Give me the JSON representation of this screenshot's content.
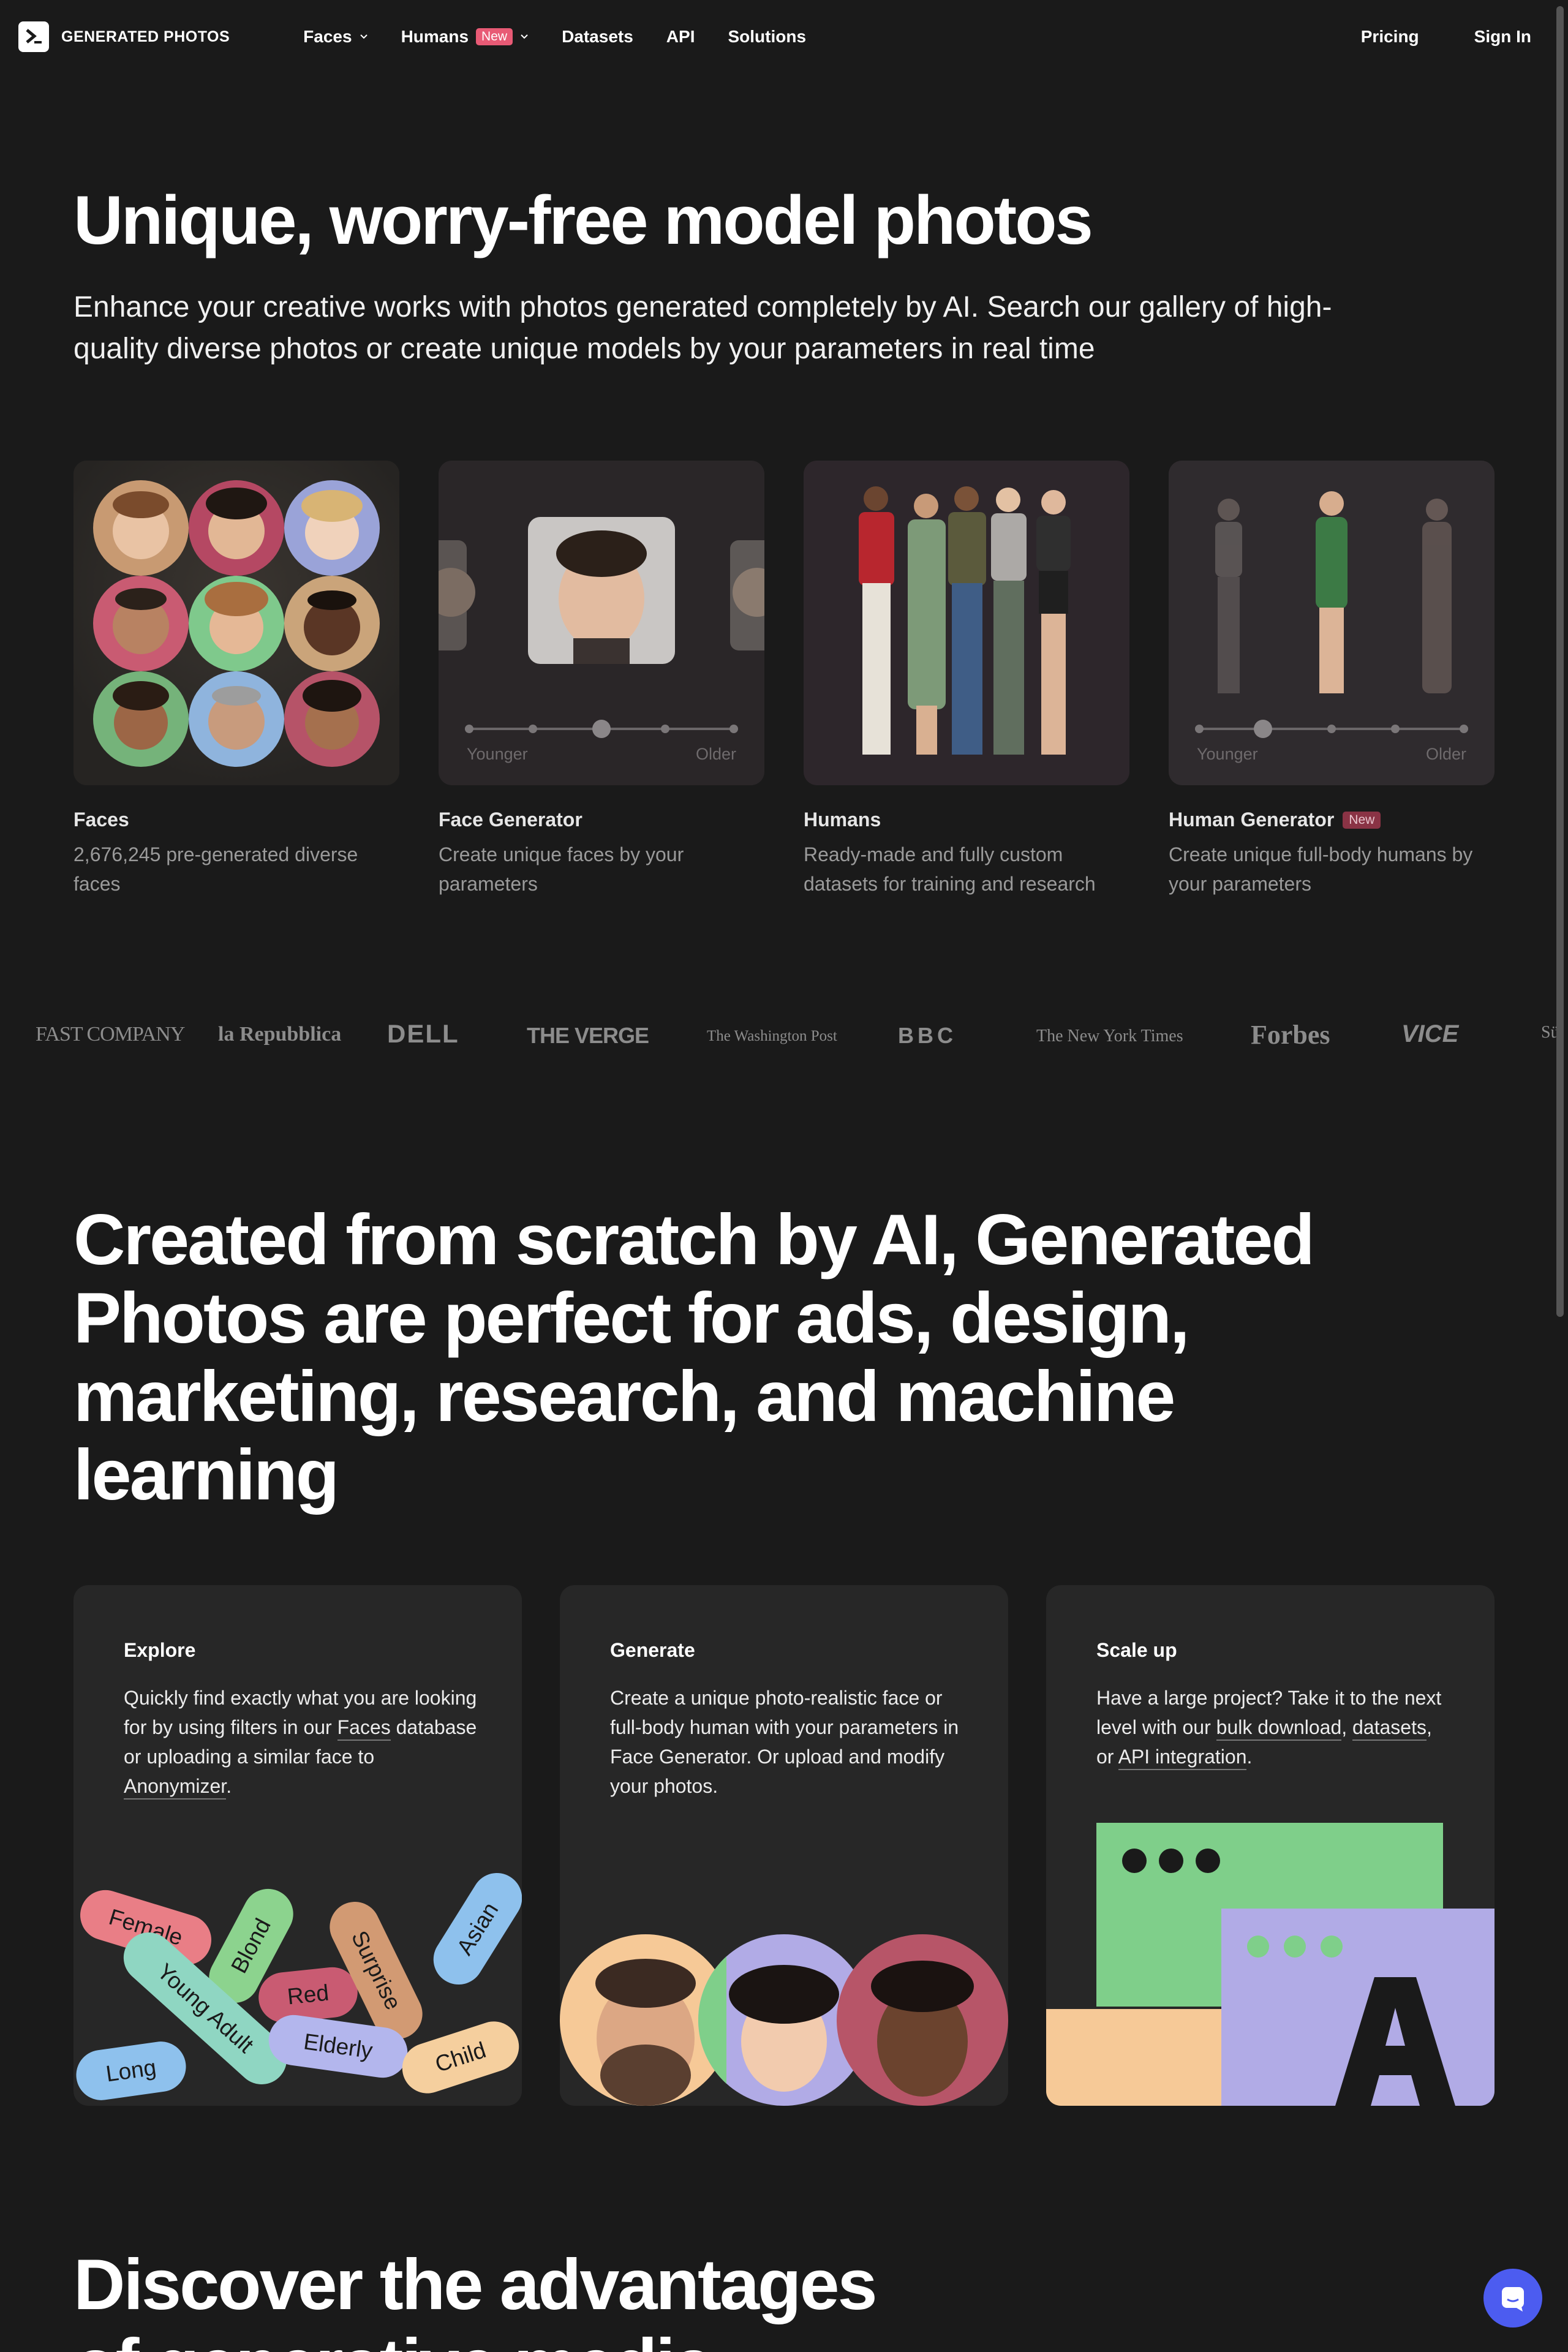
{
  "nav": {
    "logo_text": "GENERATED PHOTOS",
    "links": [
      {
        "label": "Faces",
        "dropdown": true
      },
      {
        "label": "Humans",
        "badge": "New",
        "dropdown": true
      },
      {
        "label": "Datasets"
      },
      {
        "label": "API"
      },
      {
        "label": "Solutions"
      }
    ],
    "right": [
      "Pricing",
      "Sign In"
    ]
  },
  "hero": {
    "title": "Unique, worry-free model photos",
    "subtitle": "Enhance your creative works with photos generated completely by AI. Search our gallery of high-quality diverse photos or create unique models by your parameters in real time"
  },
  "products": [
    {
      "title": "Faces",
      "desc": "2,676,245 pre-generated diverse faces"
    },
    {
      "title": "Face Generator",
      "desc": "Create unique faces by your parameters",
      "slider_min": "Younger",
      "slider_max": "Older"
    },
    {
      "title": "Humans",
      "desc": "Ready-made and fully custom datasets for training and research"
    },
    {
      "title": "Human Generator",
      "badge": "New",
      "desc": "Create unique full-body humans by your parameters",
      "slider_min": "Younger",
      "slider_max": "Older"
    }
  ],
  "press_logos": [
    "FAST COMPANY",
    "la Repubblica",
    "DELL",
    "THE VERGE",
    "The Washington Post",
    "BBC",
    "The New York Times",
    "Forbes",
    "VICE",
    "Sü"
  ],
  "section2": {
    "title": "Created from scratch by AI, Generated Photos are perfect for ads, design, marketing, research, and machine learning"
  },
  "features": {
    "explore": {
      "title": "Explore",
      "desc_a": "Quickly find exactly what you are looking for by using filters in our ",
      "link1": "Faces",
      "desc_b": " database or uploading a similar face to ",
      "link2": "Anonymizer",
      "desc_c": ".",
      "tags": [
        "Female",
        "Blond",
        "Red",
        "Surprise",
        "Asian",
        "Young Adult",
        "Elderly",
        "Long",
        "Child"
      ]
    },
    "generate": {
      "title": "Generate",
      "desc": "Create a unique photo-realistic face or full-body human with your parameters in Face Generator. Or upload and modify your photos."
    },
    "scale": {
      "title": "Scale up",
      "desc_a": "Have a large project? Take it to the next level with our ",
      "link1": "bulk download",
      "desc_b": ", ",
      "link2": "datasets",
      "desc_c": ", or ",
      "link3": "API integration",
      "desc_d": "."
    }
  },
  "bottom": {
    "title": "Discover the advantages",
    "title2": "of generative media"
  },
  "colors": {
    "background": "#1a1a1a",
    "card": "#272727",
    "accent_pink": "#e85a75",
    "chat_blue": "#4c5cf0"
  }
}
